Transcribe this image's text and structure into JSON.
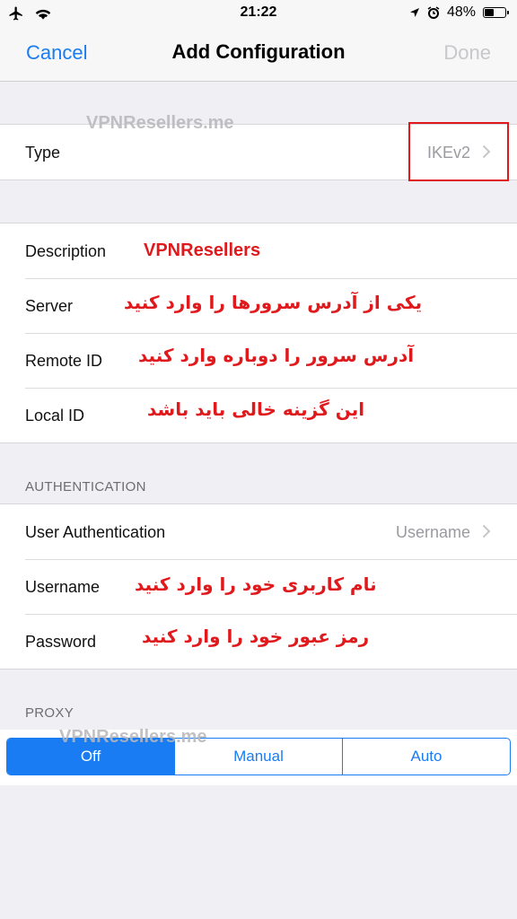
{
  "status_bar": {
    "time": "21:22",
    "battery": "48%",
    "battery_level": 0.48
  },
  "nav": {
    "cancel": "Cancel",
    "title": "Add Configuration",
    "done": "Done"
  },
  "watermark": "VPNResellers.me",
  "type_row": {
    "label": "Type",
    "value": "IKEv2"
  },
  "config_rows": [
    {
      "label": "Description",
      "annotation": "VPNResellers"
    },
    {
      "label": "Server",
      "annotation": "یکی از آدرس سرورها را وارد کنید"
    },
    {
      "label": "Remote ID",
      "annotation": "آدرس سرور را دوباره وارد کنید"
    },
    {
      "label": "Local ID",
      "annotation": "این گزینه خالی باید باشد"
    }
  ],
  "authentication": {
    "header": "AUTHENTICATION",
    "user_auth": {
      "label": "User Authentication",
      "value": "Username"
    },
    "username": {
      "label": "Username",
      "annotation": "نام کاربری خود را وارد کنید"
    },
    "password": {
      "label": "Password",
      "annotation": "رمز عبور خود را وارد کنید"
    }
  },
  "proxy": {
    "header": "PROXY",
    "options": [
      "Off",
      "Manual",
      "Auto"
    ],
    "selected": "Off"
  },
  "colors": {
    "accent": "#1a7cf2",
    "annotation_red": "#e0191c",
    "background": "#efeff4"
  }
}
